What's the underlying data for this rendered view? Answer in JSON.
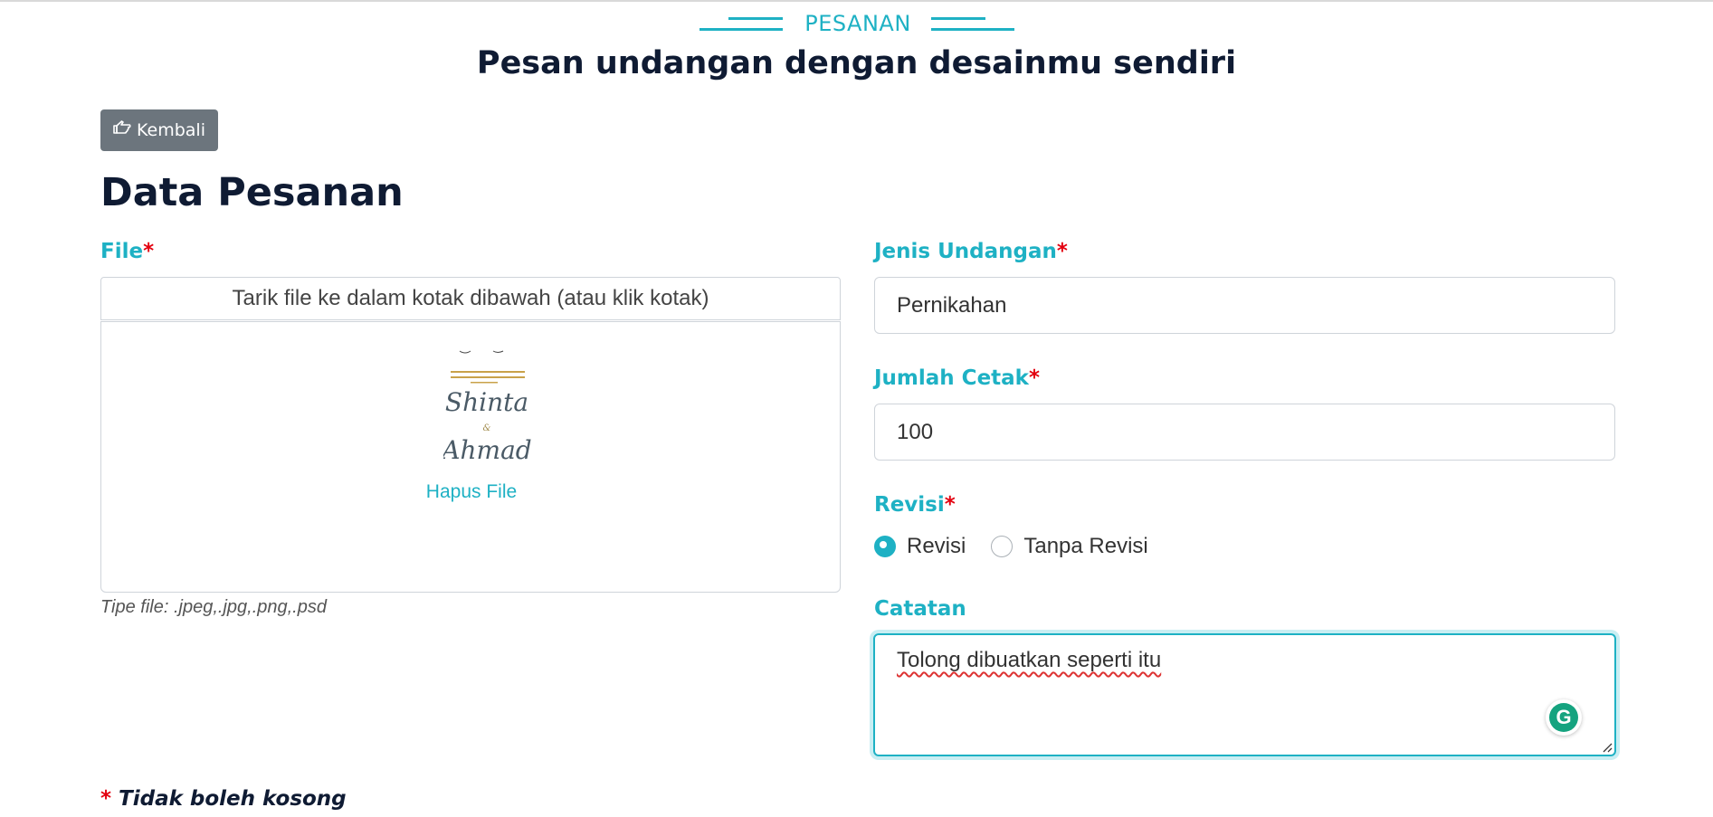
{
  "section": {
    "label": "PESANAN",
    "subtitle": "Pesan undangan dengan desainmu sendiri"
  },
  "back_button": {
    "label": "Kembali",
    "icon": "hand-pointing-left-icon"
  },
  "form": {
    "title": "Data Pesanan",
    "required_mark": "*",
    "file": {
      "label": "File",
      "hint": "Tarik file ke dalam kotak dibawah (atau klik kotak)",
      "remove_label": "Hapus File",
      "type_note": "Tipe file: .jpeg,.jpg,.png,.psd",
      "preview": {
        "line1": "Shinta",
        "line2": "&",
        "line3": "Ahmad"
      }
    },
    "jenis_undangan": {
      "label": "Jenis Undangan",
      "value": "Pernikahan"
    },
    "jumlah_cetak": {
      "label": "Jumlah Cetak",
      "value": "100"
    },
    "revisi": {
      "label": "Revisi",
      "options": [
        {
          "label": "Revisi",
          "selected": true
        },
        {
          "label": "Tanpa Revisi",
          "selected": false
        }
      ]
    },
    "catatan": {
      "label": "Catatan",
      "value": "Tolong dibuatkan seperti itu"
    },
    "required_note": "Tidak boleh kosong"
  },
  "colors": {
    "accent": "#1eb1c4",
    "required": "#e3000f",
    "button": "#6c757d",
    "heading": "#0f1b33"
  }
}
